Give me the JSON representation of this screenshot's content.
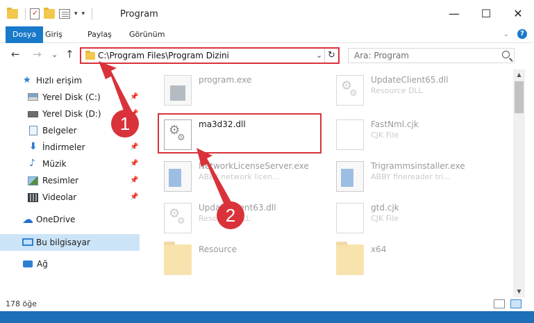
{
  "window": {
    "title": "Program",
    "controls": {
      "minimize": "—",
      "maximize": "☐",
      "close": "✕"
    }
  },
  "ribbon": {
    "tabs": [
      "Dosya",
      "Giriş",
      "Paylaş",
      "Görünüm"
    ],
    "active_tab": "Dosya",
    "help": "?"
  },
  "nav": {
    "back": "←",
    "forward": "→",
    "recent": "⌄",
    "up": "↑",
    "address": "C:\\Program Files\\Program Dizini",
    "search_placeholder": "Ara: Program"
  },
  "sidebar": {
    "items": [
      {
        "label": "Hızlı erişim",
        "icon": "star-icon"
      },
      {
        "label": "Yerel Disk (C:)",
        "icon": "disk-icon",
        "pinned": true
      },
      {
        "label": "Yerel Disk (D:)",
        "icon": "disk-icon",
        "pinned": true
      },
      {
        "label": "Belgeler",
        "icon": "documents-icon",
        "pinned": true
      },
      {
        "label": "İndirmeler",
        "icon": "download-icon",
        "pinned": true
      },
      {
        "label": "Müzik",
        "icon": "music-icon",
        "pinned": true
      },
      {
        "label": "Resimler",
        "icon": "pictures-icon",
        "pinned": true
      },
      {
        "label": "Videolar",
        "icon": "video-icon",
        "pinned": true
      },
      {
        "label": "OneDrive",
        "icon": "cloud-icon"
      },
      {
        "label": "Bu bilgisayar",
        "icon": "computer-icon",
        "selected": true
      },
      {
        "label": "Ağ",
        "icon": "network-icon"
      }
    ]
  },
  "files": [
    {
      "name": "program.exe",
      "sub": "",
      "icon": "exe-icon",
      "faded": true
    },
    {
      "name": "UpdateClient65.dll",
      "sub": "Resource DLL",
      "icon": "gear-file-icon",
      "faded": true
    },
    {
      "name": "ma3d32.dll",
      "sub": "",
      "icon": "gear-file-icon",
      "faded": false
    },
    {
      "name": "FastNml.cjk",
      "sub": "CJK File",
      "icon": "document-icon",
      "faded": true
    },
    {
      "name": "NetworkLicenseServer.exe",
      "sub": "ABBY network licen...",
      "icon": "app-icon",
      "faded": true
    },
    {
      "name": "Trigrammsinstaller.exe",
      "sub": "ABBY finereader tri...",
      "icon": "app-icon",
      "faded": true
    },
    {
      "name": "UpdateClient63.dll",
      "sub": "Resource DLL",
      "icon": "gear-file-icon",
      "faded": true
    },
    {
      "name": "gtd.cjk",
      "sub": "CJK File",
      "icon": "document-icon",
      "faded": true
    },
    {
      "name": "Resource",
      "sub": "",
      "icon": "folder-icon",
      "faded": true
    },
    {
      "name": "x64",
      "sub": "",
      "icon": "folder-icon",
      "faded": true
    }
  ],
  "status": {
    "count": "178 öğe"
  },
  "annotations": {
    "step1": "1",
    "step2": "2"
  },
  "colors": {
    "accent": "#1979ca",
    "highlight": "#d9323b",
    "selection": "#cce4f7"
  }
}
